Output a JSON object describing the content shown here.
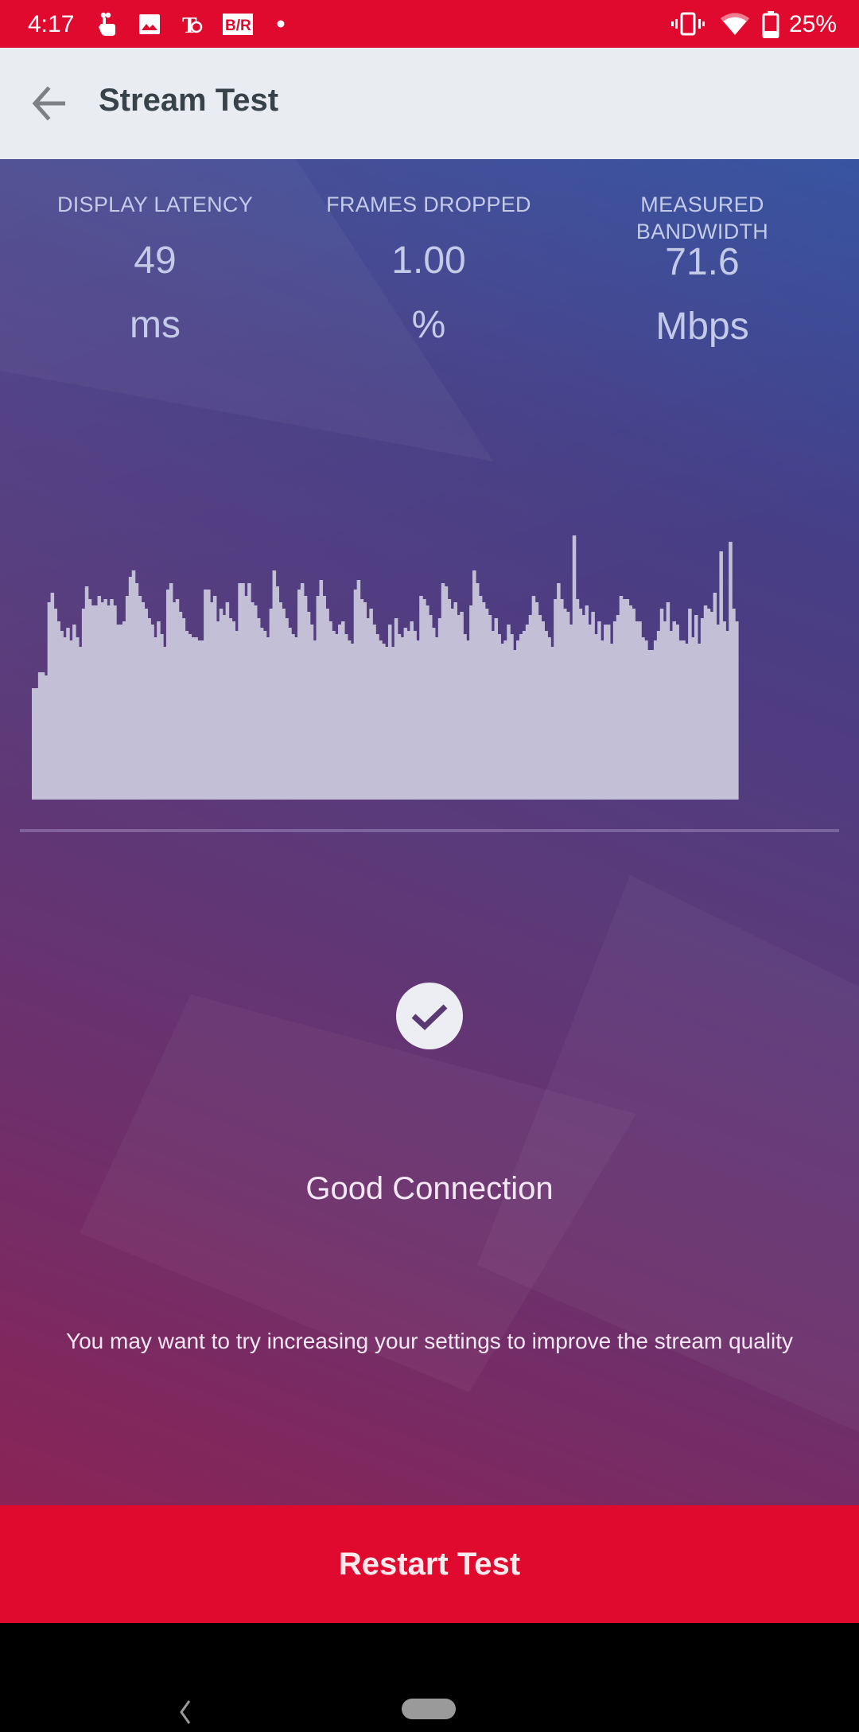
{
  "status_bar": {
    "time": "4:17",
    "notification_icons": [
      "touch-gesture-icon",
      "image-icon",
      "nytimes-icon",
      "bleacher-report-icon",
      "more-dot-icon"
    ],
    "system_icons": [
      "vibrate-icon",
      "wifi-icon",
      "battery-icon"
    ],
    "battery_percent": "25%"
  },
  "app_bar": {
    "back_icon": "arrow-back-icon",
    "title": "Stream Test"
  },
  "stats": [
    {
      "label": "DISPLAY LATENCY",
      "value": "49",
      "unit": "ms"
    },
    {
      "label": "FRAMES DROPPED",
      "value": "1.00",
      "unit": "%"
    },
    {
      "label": "MEASURED\nBANDWIDTH",
      "value": "71.6",
      "unit": "Mbps"
    }
  ],
  "chart_data": {
    "type": "bar",
    "title": "",
    "xlabel": "",
    "ylabel": "",
    "ylim": [
      0,
      100
    ],
    "grid": false,
    "legend": "none",
    "note": "Bandwidth histogram; values are relative heights (0-100) estimated from the screenshot",
    "values": [
      35,
      35,
      40,
      40,
      39,
      62,
      65,
      60,
      56,
      53,
      51,
      54,
      50,
      55,
      51,
      48,
      60,
      67,
      63,
      61,
      61,
      64,
      62,
      63,
      61,
      63,
      61,
      55,
      55,
      56,
      64,
      70,
      72,
      68,
      64,
      62,
      60,
      57,
      55,
      51,
      56,
      52,
      48,
      66,
      68,
      62,
      63,
      59,
      57,
      53,
      52,
      51,
      51,
      50,
      50,
      66,
      66,
      62,
      64,
      56,
      60,
      58,
      62,
      57,
      56,
      53,
      68,
      68,
      64,
      68,
      62,
      61,
      57,
      54,
      53,
      51,
      60,
      72,
      67,
      62,
      60,
      57,
      54,
      52,
      51,
      66,
      68,
      64,
      59,
      55,
      50,
      64,
      69,
      64,
      60,
      56,
      53,
      52,
      55,
      56,
      52,
      50,
      49,
      66,
      69,
      63,
      62,
      57,
      60,
      55,
      52,
      50,
      49,
      48,
      55,
      48,
      57,
      52,
      51,
      54,
      53,
      56,
      53,
      50,
      64,
      63,
      61,
      58,
      54,
      51,
      57,
      68,
      67,
      63,
      60,
      62,
      58,
      59,
      52,
      50,
      61,
      72,
      68,
      64,
      62,
      60,
      58,
      53,
      57,
      52,
      49,
      50,
      55,
      52,
      47,
      50,
      52,
      53,
      55,
      58,
      64,
      62,
      58,
      56,
      53,
      51,
      48,
      63,
      68,
      63,
      60,
      59,
      55,
      83,
      63,
      60,
      58,
      61,
      55,
      59,
      52,
      56,
      50,
      55,
      55,
      49,
      56,
      58,
      64,
      63,
      63,
      61,
      60,
      56,
      56,
      51,
      50,
      47,
      47,
      50,
      53,
      60,
      56,
      62,
      53,
      56,
      55,
      50,
      50,
      49,
      60,
      51,
      58,
      49,
      57,
      61,
      60,
      59,
      65,
      55,
      78,
      56,
      53,
      81,
      60,
      56
    ]
  },
  "result": {
    "icon": "check-circle-icon",
    "title": "Good Connection",
    "hint": "You may want to try increasing your settings to improve the stream quality"
  },
  "actions": {
    "restart_label": "Restart Test"
  },
  "nav_bar": {
    "back_icon": "nav-back-icon",
    "home_icon": "nav-home-pill-icon"
  },
  "colors": {
    "accent_red": "#e00a2f",
    "app_bar_bg": "#e9edf1",
    "title_text": "#37424a",
    "chart_fill": "#c3bfd6",
    "stat_text": "#c4cbe8"
  }
}
